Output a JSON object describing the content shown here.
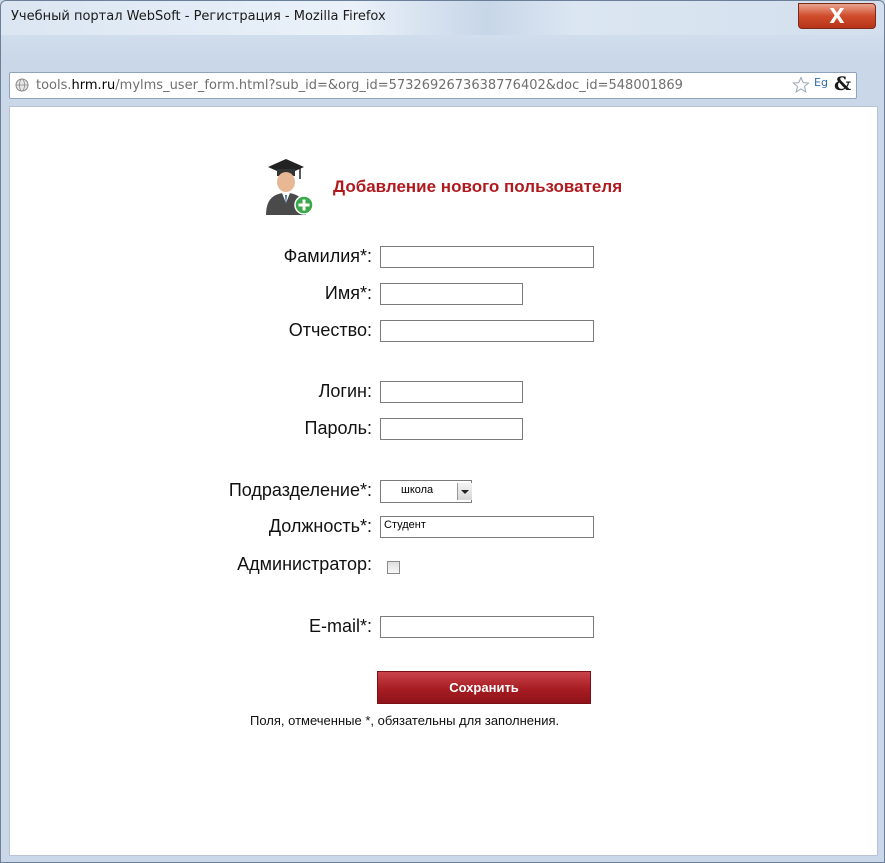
{
  "window": {
    "title": "Учебный портал WebSoft - Регистрация - Mozilla Firefox",
    "close_label": "X"
  },
  "address_bar": {
    "url_prefix": "tools.",
    "url_host": "hrm.ru",
    "url_rest": "/mylms_user_form.html?sub_id=&org_id=5732692673638776402&doc_id=548001869",
    "lang_label": "Eg",
    "amp_label": "&"
  },
  "form": {
    "heading": "Добавление нового пользователя",
    "fields": {
      "last_name_label": "Фамилия*:",
      "first_name_label": "Имя*:",
      "middle_name_label": "Отчество:",
      "login_label": "Логин:",
      "password_label": "Пароль:",
      "department_label": "Подразделение*:",
      "department_value": "школа",
      "position_label": "Должность*:",
      "position_value": "Студент",
      "admin_label": "Администратор:",
      "email_label": "E-mail*:"
    },
    "admin_checked": false,
    "save_label": "Сохранить",
    "required_note": "Поля, отмеченные *, обязательны для заполнения."
  },
  "colors": {
    "accent": "#b01a1e",
    "button": "#a61c22"
  }
}
